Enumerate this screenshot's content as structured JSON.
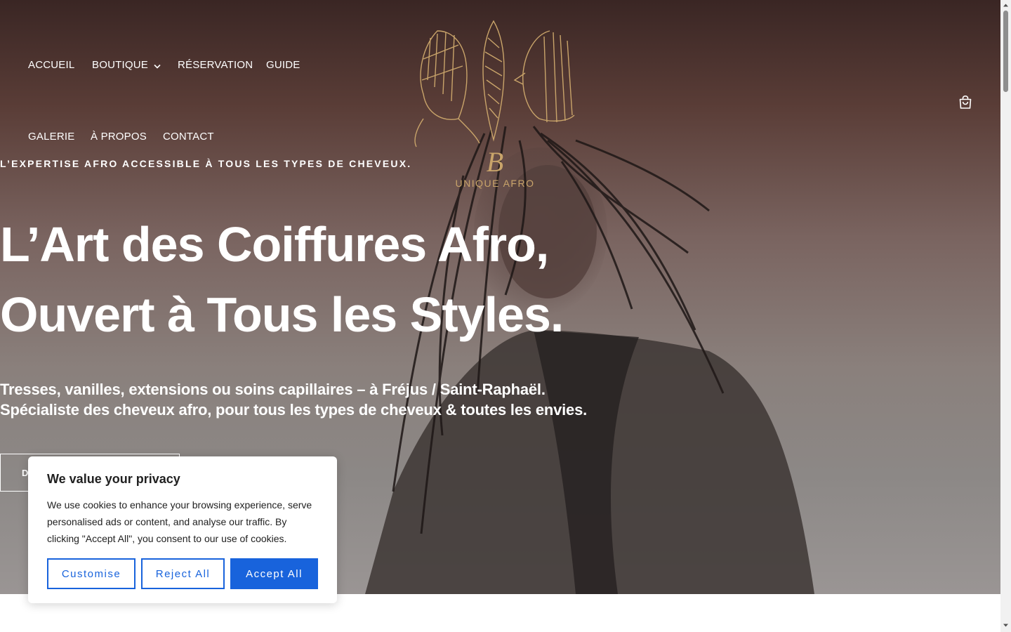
{
  "nav": {
    "items": [
      {
        "label": "ACCUEIL"
      },
      {
        "label": "BOUTIQUE"
      },
      {
        "label": "RÉSERVATION"
      },
      {
        "label": "GUIDE"
      },
      {
        "label": "GALERIE"
      },
      {
        "label": "À PROPOS"
      },
      {
        "label": "CONTACT"
      }
    ]
  },
  "logo": {
    "monogram": "B",
    "brand": "UNIQUE AFRO"
  },
  "hero": {
    "eyebrow": "L’EXPERTISE AFRO ACCESSIBLE À TOUS LES TYPES DE CHEVEUX.",
    "headline_line1": "L’Art des Coiffures Afro,",
    "headline_line2": "Ouvert à Tous les Styles.",
    "sub_line1": "Tresses, vanilles, extensions ou soins capillaires – à Fréjus / Saint-Raphaël.",
    "sub_line2": "Spécialiste des cheveux afro, pour tous les types de cheveux & toutes les envies.",
    "cta_label": "D"
  },
  "cookie_banner": {
    "title": "We value your privacy",
    "text": "We use cookies to enhance your browsing experience, serve personalised ads or content, and analyse our traffic. By clicking \"Accept All\", you consent to our use of cookies.",
    "customise_label": "Customise",
    "reject_label": "Reject All",
    "accept_label": "Accept All"
  },
  "icons": {
    "cart": "shopping-bag-icon",
    "dropdown": "chevron-down-icon"
  },
  "colors": {
    "accent": "#1863dc",
    "logo_gold": "#c9a46a"
  }
}
